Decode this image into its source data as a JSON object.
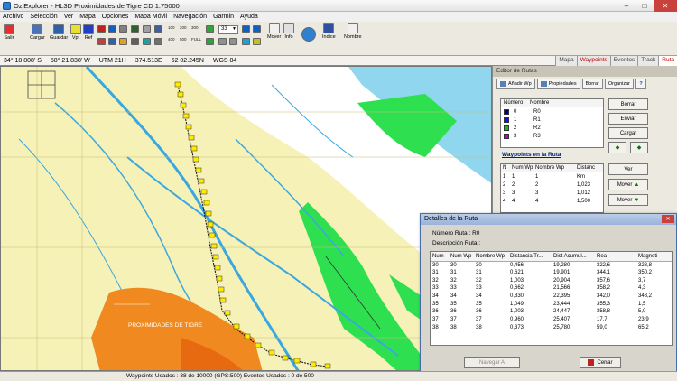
{
  "window": {
    "title": "OziExplorer - HL3D Proximidades de Tigre CD 1:75000"
  },
  "menu": [
    "Archivo",
    "Selección",
    "Ver",
    "Mapa",
    "Opciones",
    "Mapa Móvil",
    "Navegación",
    "Garmin",
    "Ayuda"
  ],
  "toolbar": {
    "buttons": [
      {
        "label": "Salir"
      },
      {
        "label": "Cargar"
      },
      {
        "label": "Guardar"
      },
      {
        "label": "Vpt"
      },
      {
        "label": "Ref"
      },
      {
        "label": "Mover"
      },
      {
        "label": "Info"
      },
      {
        "label": "Indice"
      },
      {
        "label": "Nombre"
      }
    ],
    "zoom_labels": [
      "100",
      "200",
      "300",
      "400",
      "500",
      "FULL"
    ],
    "zoom_value": "33"
  },
  "coords": {
    "lat": "34° 18,808' S",
    "lon": "58° 21,838' W",
    "utm": "UTM 21H",
    "east": "374.513E",
    "north": "62 02.245N",
    "datum": "WGS 84"
  },
  "tabs": [
    "Mapa",
    "Waypoints",
    "Eventos",
    "Track",
    "Ruta"
  ],
  "active_tab": "Ruta",
  "route_editor": {
    "header": "Editor de Rutas",
    "tabs": [
      "Añadir Wp",
      "Propiedades",
      "Borrar",
      "Organizar"
    ],
    "help": "?",
    "list_headers": [
      "Número",
      "Nombre"
    ],
    "routes": [
      {
        "num": "0",
        "name": "R0",
        "color": "#000080"
      },
      {
        "num": "1",
        "name": "R1",
        "color": "#1010ff"
      },
      {
        "num": "2",
        "name": "R2",
        "color": "#10c010"
      },
      {
        "num": "3",
        "name": "R3",
        "color": "#c000c0"
      }
    ],
    "buttons": {
      "delete": "Borrar",
      "send": "Enviar",
      "load": "Cargar",
      "view": "Ver",
      "move_up": "Mover",
      "move_down": "Mover"
    },
    "wp_title": "Waypoints en la Ruta",
    "wp_headers": [
      "N",
      "Num Wp",
      "Nombre Wp",
      "Distanc"
    ],
    "waypoints": [
      {
        "n": "1",
        "num": "1",
        "name": "1",
        "dist": "Km"
      },
      {
        "n": "2",
        "num": "2",
        "name": "2",
        "dist": "1,023"
      },
      {
        "n": "3",
        "num": "3",
        "name": "3",
        "dist": "1,012"
      },
      {
        "n": "4",
        "num": "4",
        "name": "4",
        "dist": "1,500"
      }
    ]
  },
  "map": {
    "place_label": "PROXIMIDADES DE TIGRE"
  },
  "dialog": {
    "title": "Detalles de la Ruta",
    "route_number_label": "Número Ruta : R0",
    "description_label": "Descripción Ruta :",
    "headers": [
      "Num",
      "Num Wp",
      "Nombre Wp",
      "Distancia Tr...",
      "Dist Acumul...",
      "Real",
      "Magneti"
    ],
    "rows": [
      [
        "30",
        "30",
        "30",
        "0,456",
        "19,280",
        "322,6",
        "328,8"
      ],
      [
        "31",
        "31",
        "31",
        "0,621",
        "19,901",
        "344,1",
        "350,2"
      ],
      [
        "32",
        "32",
        "32",
        "1,003",
        "20,904",
        "357,6",
        "3,7"
      ],
      [
        "33",
        "33",
        "33",
        "0,662",
        "21,566",
        "358,2",
        "4,3"
      ],
      [
        "34",
        "34",
        "34",
        "0,830",
        "22,395",
        "342,0",
        "348,2"
      ],
      [
        "35",
        "35",
        "35",
        "1,049",
        "23,444",
        "355,3",
        "1,5"
      ],
      [
        "36",
        "36",
        "36",
        "1,003",
        "24,447",
        "358,8",
        "5,0"
      ],
      [
        "37",
        "37",
        "37",
        "0,960",
        "25,407",
        "17,7",
        "23,9"
      ],
      [
        "38",
        "38",
        "38",
        "0,373",
        "25,780",
        "59,0",
        "65,2"
      ]
    ],
    "nav_button": "Navegar A",
    "close_button": "Cerrar"
  },
  "status": {
    "text": "Waypoints Usados : 38 de 10000 (GPS:500)   Eventos Usados : 0 de 500"
  }
}
